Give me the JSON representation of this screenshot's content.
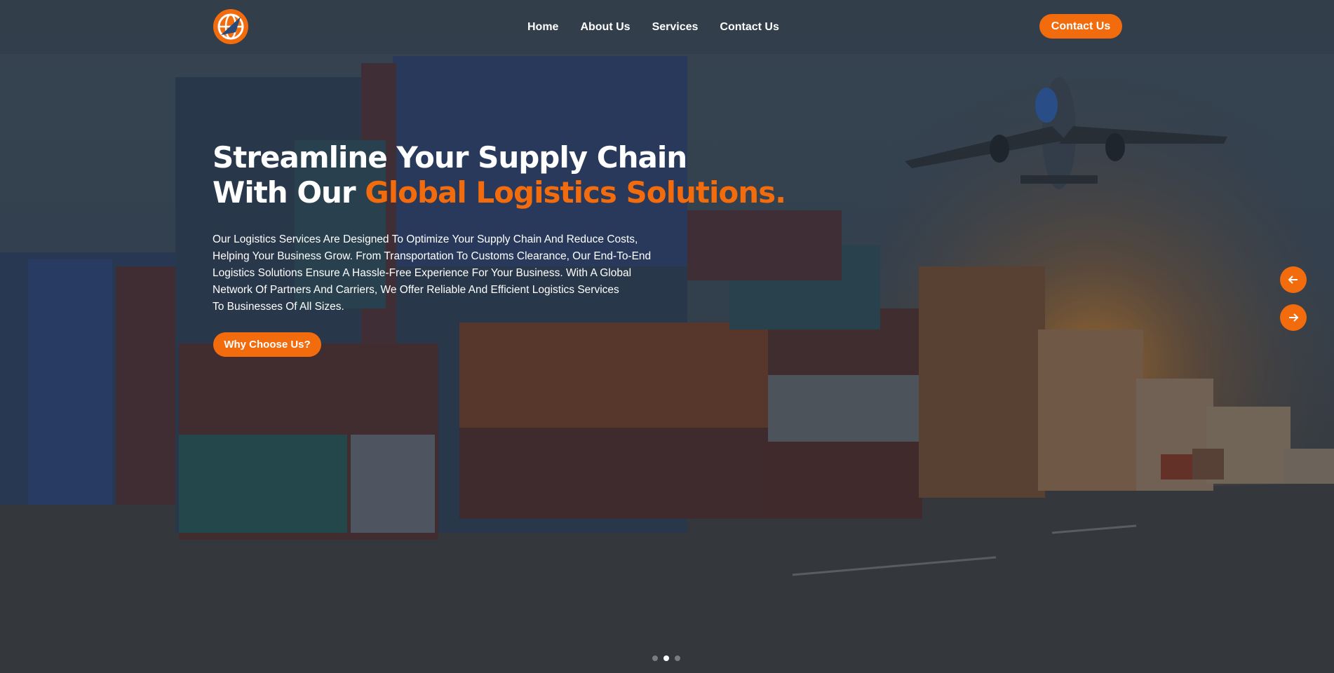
{
  "brand": {
    "logo_icon": "globe-plane-logo",
    "accent_color": "#f26c0d"
  },
  "nav": {
    "items": [
      {
        "label": "Home"
      },
      {
        "label": "About Us"
      },
      {
        "label": "Services"
      },
      {
        "label": "Contact Us"
      }
    ],
    "cta_label": "Contact Us"
  },
  "hero": {
    "headline_line1": "Streamline Your Supply Chain",
    "headline_line2_prefix": "With Our ",
    "headline_line2_accent": "Global Logistics Solutions.",
    "description_lines": [
      "Our Logistics Services Are Designed To Optimize Your Supply Chain And Reduce Costs,",
      "Helping Your Business Grow. From Transportation To Customs Clearance, Our End-To-End",
      "Logistics Solutions Ensure A Hassle-Free Experience For Your Business. With A Global",
      "Network Of Partners And Carriers, We Offer Reliable And Efficient Logistics Services",
      "To Businesses Of All Sizes."
    ],
    "cta_label": "Why Choose Us?",
    "background": "shipping containers port with airplane"
  },
  "slider": {
    "prev_icon": "arrow-left-icon",
    "next_icon": "arrow-right-icon",
    "slide_count": 3,
    "active_slide": 2
  }
}
